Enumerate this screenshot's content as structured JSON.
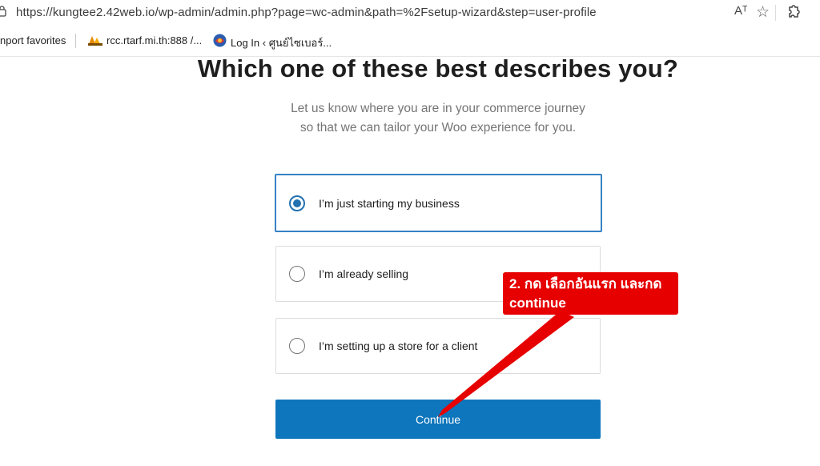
{
  "browser": {
    "url": "https://kungtee2.42web.io/wp-admin/admin.php?page=wc-admin&path=%2Fsetup-wizard&step=user-profile",
    "read_aloud_label": "Aᵀ",
    "star_glyph": "☆"
  },
  "favorites": [
    {
      "label": "nport favorites"
    },
    {
      "label": "rcc.rtarf.mi.th:888 /..."
    },
    {
      "label": "Log In ‹ ศูนย์ไซเบอร์..."
    }
  ],
  "page": {
    "title": "Which one of these best describes you?",
    "subtitle_line1": "Let us know where you are in your commerce journey",
    "subtitle_line2": "so that we can tailor your Woo experience for you.",
    "options": [
      {
        "label": "I’m just starting my business",
        "selected": true
      },
      {
        "label": "I’m already selling",
        "selected": false
      },
      {
        "label": "I’m setting up a store for a client",
        "selected": false
      }
    ],
    "continue_label": "Continue"
  },
  "annotation": {
    "line1": "2. กด เลือกอันแรก และกด",
    "line2": "continue",
    "color": "#e60000"
  },
  "colors": {
    "accent": "#2271b1",
    "button": "#0e76bc"
  }
}
